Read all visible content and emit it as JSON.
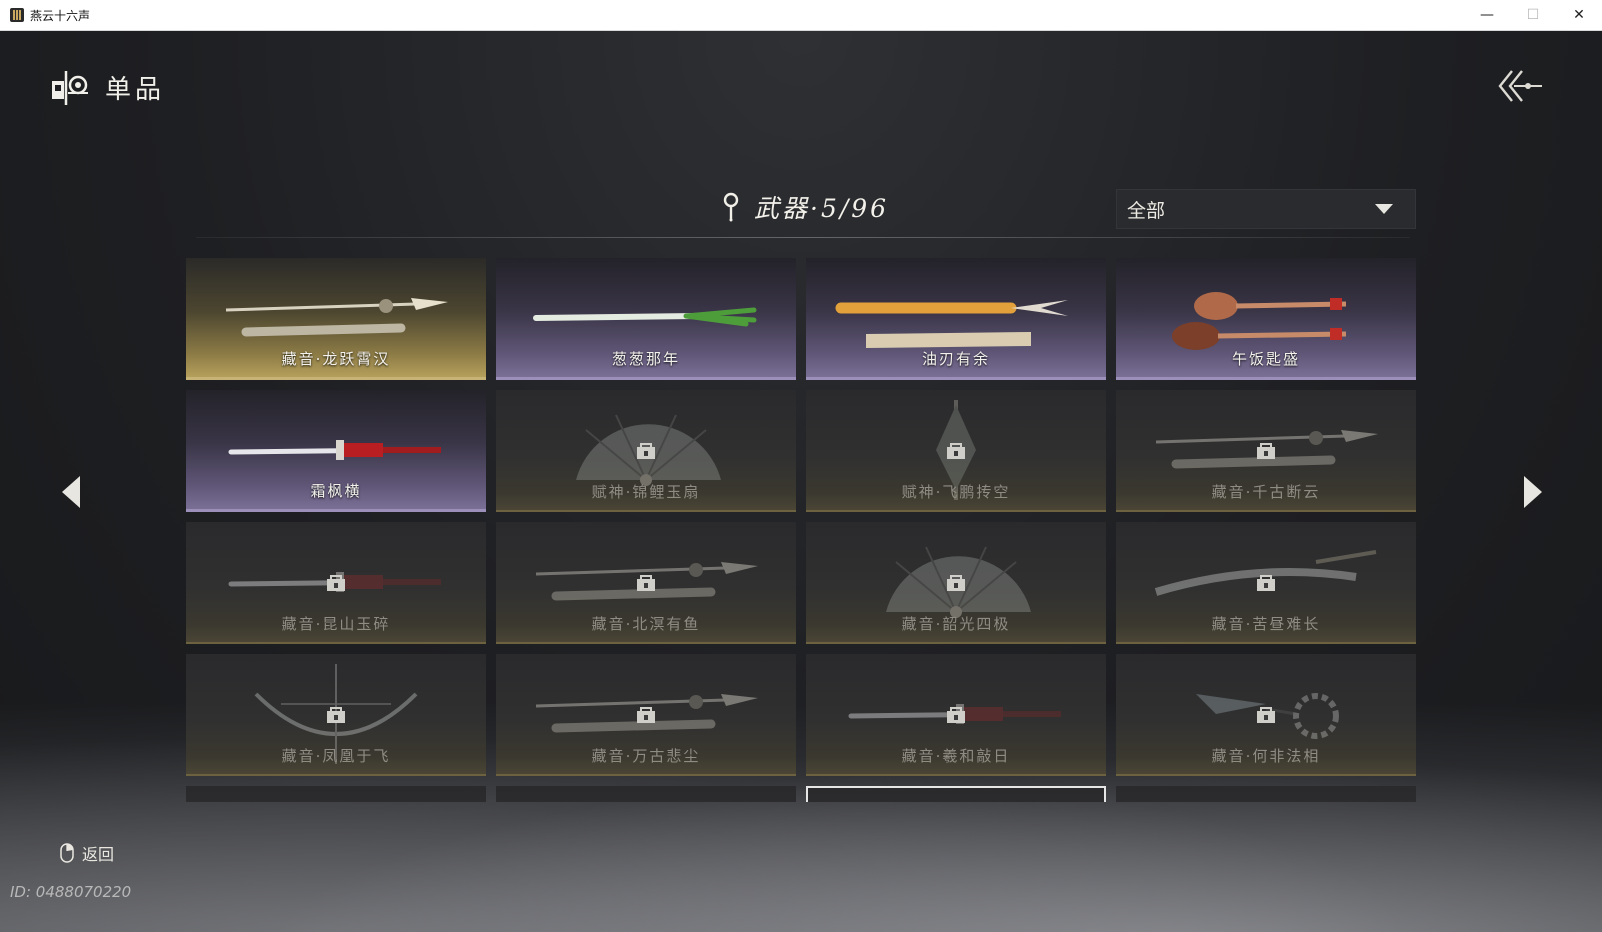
{
  "window": {
    "title": "燕云十六声",
    "minimize": "—",
    "maximize": "☐",
    "close": "✕"
  },
  "header": {
    "title": "单品",
    "icon": "collection-icon",
    "back_icon": "double-chevron-back-icon"
  },
  "category": {
    "label": "武器·5/96",
    "icon": "location-pin-icon"
  },
  "filter": {
    "value": "全部"
  },
  "items": [
    {
      "name": "藏音·龙跃霄汉",
      "rarity": "gold",
      "locked": false,
      "art": "spear-icon"
    },
    {
      "name": "葱葱那年",
      "rarity": "purple",
      "locked": false,
      "art": "scallion-icon"
    },
    {
      "name": "油刃有余",
      "rarity": "purple",
      "locked": false,
      "art": "fried-dough-sword-icon"
    },
    {
      "name": "午饭匙盛",
      "rarity": "purple",
      "locked": false,
      "art": "spoon-icon"
    },
    {
      "name": "霜枫横",
      "rarity": "purple",
      "locked": false,
      "art": "sword-icon"
    },
    {
      "name": "赋神·锦鲤玉扇",
      "rarity": "locked",
      "locked": true,
      "art": "fan-icon"
    },
    {
      "name": "赋神·飞鹏抟空",
      "rarity": "locked",
      "locked": true,
      "art": "umbrella-icon"
    },
    {
      "name": "藏音·千古断云",
      "rarity": "locked",
      "locked": true,
      "art": "spear-icon"
    },
    {
      "name": "藏音·昆山玉碎",
      "rarity": "locked",
      "locked": true,
      "art": "sword-icon"
    },
    {
      "name": "藏音·北溟有鱼",
      "rarity": "locked",
      "locked": true,
      "art": "spear-icon"
    },
    {
      "name": "藏音·韶光四极",
      "rarity": "locked",
      "locked": true,
      "art": "fan-icon"
    },
    {
      "name": "藏音·苦昼难长",
      "rarity": "locked",
      "locked": true,
      "art": "blade-icon"
    },
    {
      "name": "藏音·凤凰于飞",
      "rarity": "locked",
      "locked": true,
      "art": "bow-icon"
    },
    {
      "name": "藏音·万古悲尘",
      "rarity": "locked",
      "locked": true,
      "art": "spear-icon"
    },
    {
      "name": "藏音·羲和敲日",
      "rarity": "locked",
      "locked": true,
      "art": "sword-icon"
    },
    {
      "name": "藏音·何非法相",
      "rarity": "locked",
      "locked": true,
      "art": "rope-dart-icon"
    }
  ],
  "partial_row": [
    "",
    "",
    "",
    ""
  ],
  "selected_partial_index": 2,
  "footer": {
    "return_label": "返回",
    "uid": "ID: 0488070220"
  }
}
